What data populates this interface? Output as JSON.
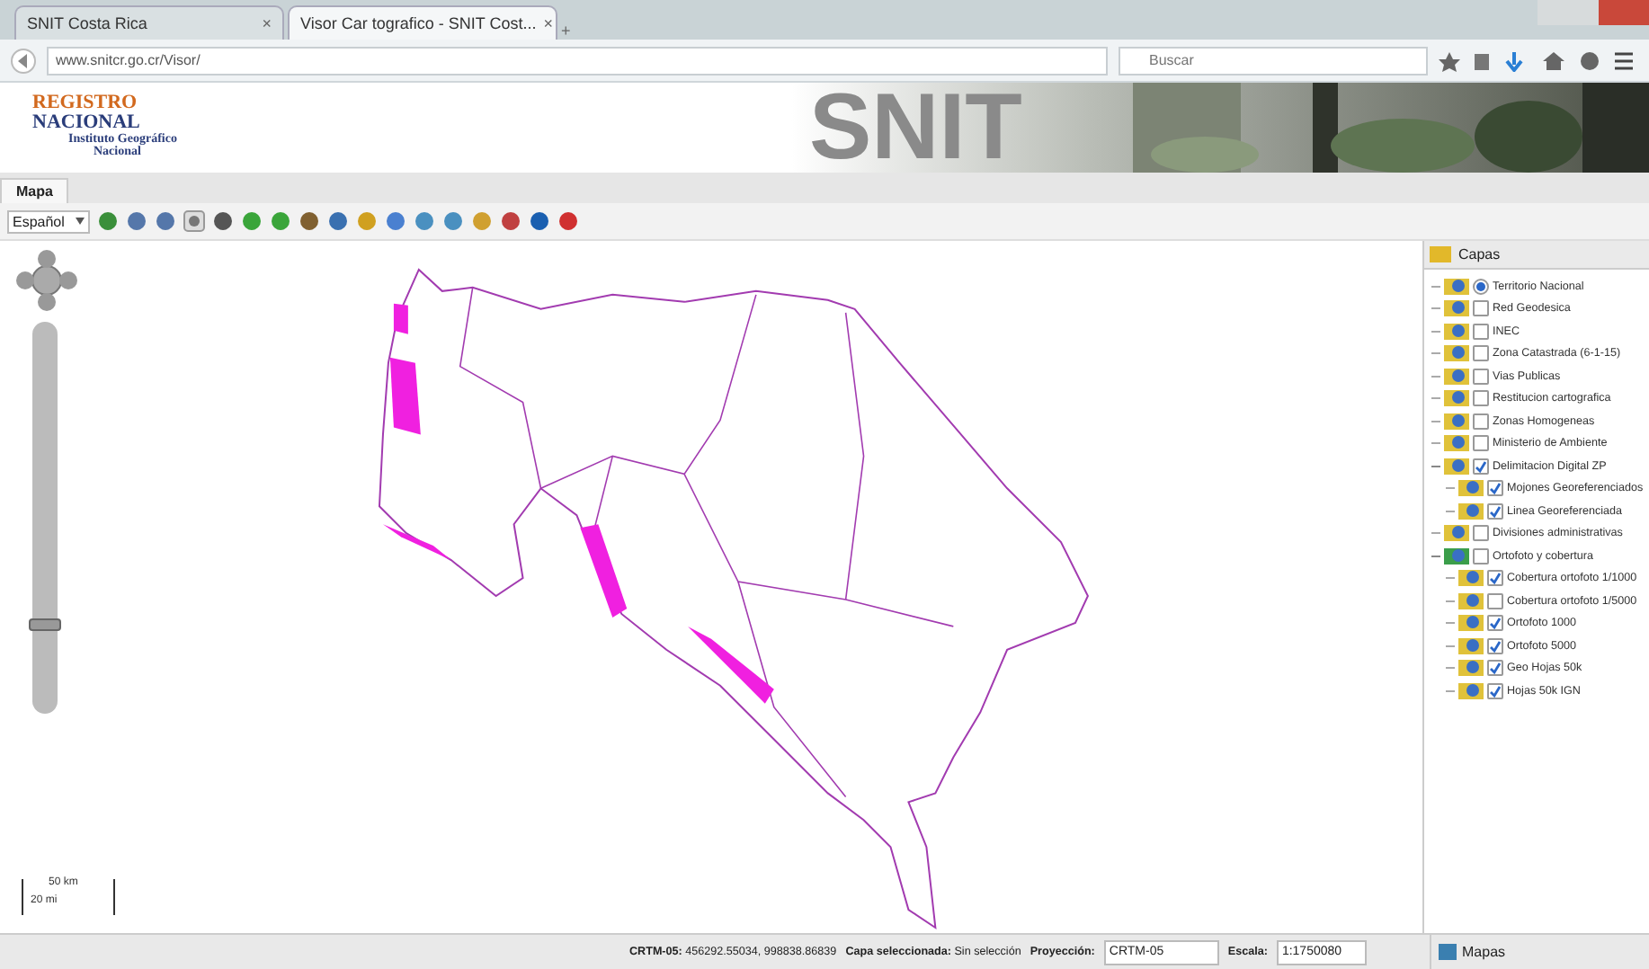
{
  "browser": {
    "tabs": [
      {
        "label": "SNIT Costa Rica",
        "close": "×",
        "selected": false
      },
      {
        "label": "Visor Car tografico - SNIT Cost...",
        "close": "×",
        "selected": true
      }
    ],
    "new_tab": "+",
    "url": "www.snitcr.go.cr/Visor/",
    "search": {
      "placeholder": "Buscar"
    }
  },
  "header": {
    "logo": [
      "REGISTRO",
      "NACIONAL",
      "Instituto Geográfico",
      "Nacional"
    ],
    "banner_title": "SNIT"
  },
  "tabs": [
    {
      "label": "Mapa",
      "selected": true
    }
  ],
  "toolbar": {
    "language": "Español"
  },
  "zoom_slider": {
    "level": 0.22
  },
  "scale_bar": {
    "top": "50 km",
    "bottom": "20 mi"
  },
  "layers": {
    "title": "Capas",
    "items": [
      {
        "label": "Territorio Nacional",
        "kind": "radio",
        "checked": true
      },
      {
        "label": "Red Geodesica",
        "kind": "check",
        "checked": false
      },
      {
        "label": "INEC",
        "kind": "check",
        "checked": false
      },
      {
        "label": "Zona Catastrada (6-1-15)",
        "kind": "check",
        "checked": false
      },
      {
        "label": "Vias Publicas",
        "kind": "check",
        "checked": false
      },
      {
        "label": "Restitucion cartografica",
        "kind": "check",
        "checked": false
      },
      {
        "label": "Zonas Homogeneas",
        "kind": "check",
        "checked": false
      },
      {
        "label": "Ministerio de Ambiente",
        "kind": "check",
        "checked": false
      },
      {
        "label": "Delimitacion Digital ZP",
        "kind": "check",
        "checked": true,
        "expanded": true,
        "children": [
          {
            "label": "Mojones Georeferenciados",
            "kind": "check",
            "checked": true
          },
          {
            "label": "Linea Georeferenciada",
            "kind": "check",
            "checked": true
          }
        ]
      },
      {
        "label": "Divisiones administrativas",
        "kind": "check",
        "checked": false
      },
      {
        "label": "Ortofoto y cobertura",
        "kind": "check",
        "checked": false,
        "expanded": true,
        "children": [
          {
            "label": "Cobertura ortofoto 1/1000",
            "kind": "check",
            "checked": true
          },
          {
            "label": "Cobertura ortofoto 1/5000",
            "kind": "check",
            "checked": false
          },
          {
            "label": "Ortofoto 1000",
            "kind": "check",
            "checked": true
          },
          {
            "label": "Ortofoto 5000",
            "kind": "check",
            "checked": true
          },
          {
            "label": "Geo Hojas 50k",
            "kind": "check",
            "checked": true
          },
          {
            "label": "Hojas 50k IGN",
            "kind": "check",
            "checked": true
          }
        ]
      }
    ]
  },
  "status_bar": {
    "coords_label": "CRTM-05:",
    "coords": "456292.55034, 998838.86839",
    "layer_label": "Capa seleccionada:",
    "layer": "Sin selección",
    "projection_label": "Proyección:",
    "projection": "CRTM-05",
    "scale_label": "Escala:",
    "scale": "1:1750080",
    "panel_tab": "Mapas"
  }
}
